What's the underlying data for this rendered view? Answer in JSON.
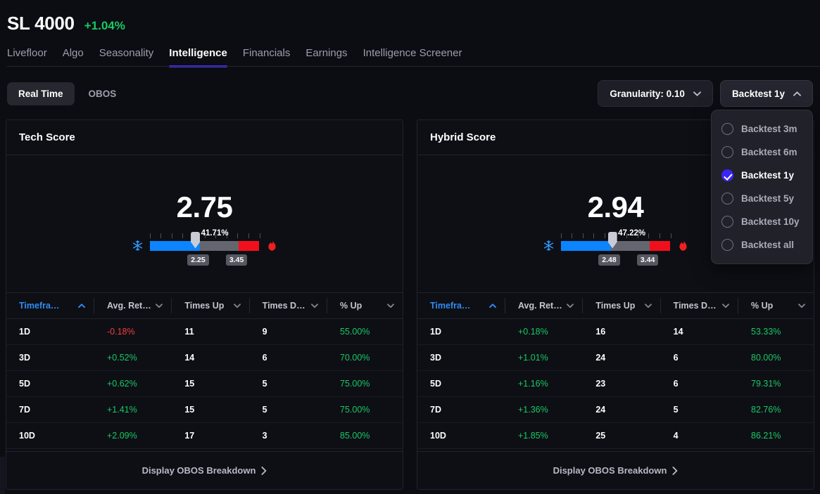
{
  "header": {
    "symbol": "SL 4000",
    "change": "+1.04%",
    "change_color": "#17c964"
  },
  "nav": {
    "items": [
      {
        "label": "Livefloor",
        "active": false
      },
      {
        "label": "Algo",
        "active": false
      },
      {
        "label": "Seasonality",
        "active": false
      },
      {
        "label": "Intelligence",
        "active": true
      },
      {
        "label": "Financials",
        "active": false
      },
      {
        "label": "Earnings",
        "active": false
      },
      {
        "label": "Intelligence Screener",
        "active": false
      }
    ],
    "active_underline_color": "#4733ff"
  },
  "controls": {
    "segments": [
      {
        "label": "Real Time",
        "active": true
      },
      {
        "label": "OBOS",
        "active": false
      }
    ],
    "granularity_label": "Granularity: 0.10",
    "backtest_label": "Backtest 1y"
  },
  "dropdown": {
    "open": true,
    "items": [
      {
        "label": "Backtest 3m",
        "selected": false
      },
      {
        "label": "Backtest 6m",
        "selected": false
      },
      {
        "label": "Backtest 1y",
        "selected": true
      },
      {
        "label": "Backtest 5y",
        "selected": false
      },
      {
        "label": "Backtest 10y",
        "selected": false
      },
      {
        "label": "Backtest all",
        "selected": false
      }
    ],
    "accent_color": "#3b25f5"
  },
  "table_headers": [
    {
      "label": "Timefra…",
      "sorted": true,
      "dir": "up"
    },
    {
      "label": "Avg. Ret…",
      "sorted": false,
      "dir": "down"
    },
    {
      "label": "Times Up",
      "sorted": false,
      "dir": "down"
    },
    {
      "label": "Times D…",
      "sorted": false,
      "dir": "down"
    },
    {
      "label": "% Up",
      "sorted": false,
      "dir": "down"
    }
  ],
  "footer_link": "Display OBOS Breakdown",
  "cards": [
    {
      "title": "Tech Score",
      "score": "2.75",
      "gauge": {
        "percent_label": "41.71%",
        "percent_value": 41.71,
        "low_label": "2.25",
        "high_label": "3.45",
        "blue_pct": 46,
        "gray_pct": 35,
        "red_pct": 19,
        "marker_pct": 41.71,
        "colors": {
          "cold": "#0b84fe",
          "neutral": "#63666f",
          "hot": "#f20f1d"
        }
      },
      "rows": [
        {
          "timeframe": "1D",
          "avg_return": "-0.18%",
          "dir": "neg",
          "times_up": "11",
          "times_down": "9",
          "pct_up": "55.00%"
        },
        {
          "timeframe": "3D",
          "avg_return": "+0.52%",
          "dir": "pos",
          "times_up": "14",
          "times_down": "6",
          "pct_up": "70.00%"
        },
        {
          "timeframe": "5D",
          "avg_return": "+0.62%",
          "dir": "pos",
          "times_up": "15",
          "times_down": "5",
          "pct_up": "75.00%"
        },
        {
          "timeframe": "7D",
          "avg_return": "+1.41%",
          "dir": "pos",
          "times_up": "15",
          "times_down": "5",
          "pct_up": "75.00%"
        },
        {
          "timeframe": "10D",
          "avg_return": "+2.09%",
          "dir": "pos",
          "times_up": "17",
          "times_down": "3",
          "pct_up": "85.00%"
        }
      ]
    },
    {
      "title": "Hybrid Score",
      "score": "2.94",
      "gauge": {
        "percent_label": "47.22%",
        "percent_value": 47.22,
        "low_label": "2.48",
        "high_label": "3.44",
        "blue_pct": 46,
        "gray_pct": 35,
        "red_pct": 19,
        "marker_pct": 47.22,
        "colors": {
          "cold": "#0b84fe",
          "neutral": "#63666f",
          "hot": "#f20f1d"
        }
      },
      "rows": [
        {
          "timeframe": "1D",
          "avg_return": "+0.18%",
          "dir": "pos",
          "times_up": "16",
          "times_down": "14",
          "pct_up": "53.33%"
        },
        {
          "timeframe": "3D",
          "avg_return": "+1.01%",
          "dir": "pos",
          "times_up": "24",
          "times_down": "6",
          "pct_up": "80.00%"
        },
        {
          "timeframe": "5D",
          "avg_return": "+1.16%",
          "dir": "pos",
          "times_up": "23",
          "times_down": "6",
          "pct_up": "79.31%"
        },
        {
          "timeframe": "7D",
          "avg_return": "+1.36%",
          "dir": "pos",
          "times_up": "24",
          "times_down": "5",
          "pct_up": "82.76%"
        },
        {
          "timeframe": "10D",
          "avg_return": "+1.85%",
          "dir": "pos",
          "times_up": "25",
          "times_down": "4",
          "pct_up": "86.21%"
        }
      ]
    }
  ]
}
